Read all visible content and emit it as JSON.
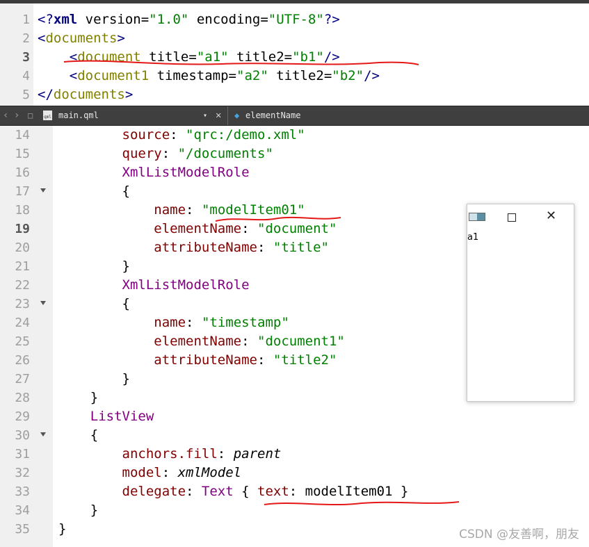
{
  "xml_editor": {
    "lines": [
      {
        "num": "1",
        "parts": [
          [
            "t-punc",
            "<?"
          ],
          [
            "t-kw",
            "xml"
          ],
          [
            "",
            " version="
          ],
          [
            "t-str",
            "\"1.0\""
          ],
          [
            "",
            " encoding="
          ],
          [
            "t-str",
            "\"UTF-8\""
          ],
          [
            "t-punc",
            "?>"
          ]
        ]
      },
      {
        "num": "2",
        "parts": [
          [
            "t-punc",
            "<"
          ],
          [
            "t-tag",
            "documents"
          ],
          [
            "t-punc",
            ">"
          ]
        ]
      },
      {
        "num": "3",
        "active": true,
        "parts": [
          [
            "",
            "    "
          ],
          [
            "t-punc",
            "<"
          ],
          [
            "t-tag",
            "document"
          ],
          [
            "",
            " title="
          ],
          [
            "t-str",
            "\"a1\""
          ],
          [
            "",
            " title2="
          ],
          [
            "t-str",
            "\"b1\""
          ],
          [
            "t-punc",
            "/>"
          ]
        ]
      },
      {
        "num": "4",
        "parts": [
          [
            "",
            "    "
          ],
          [
            "t-punc",
            "<"
          ],
          [
            "t-tag",
            "document1"
          ],
          [
            "",
            " timestamp="
          ],
          [
            "t-str",
            "\"a2\""
          ],
          [
            "",
            " title2="
          ],
          [
            "t-str",
            "\"b2\""
          ],
          [
            "t-punc",
            "/>"
          ]
        ]
      },
      {
        "num": "5",
        "parts": [
          [
            "t-punc",
            "</"
          ],
          [
            "t-tag",
            "documents"
          ],
          [
            "t-punc",
            ">"
          ]
        ]
      }
    ]
  },
  "toolbar": {
    "file_name": "main.qml",
    "symbol_name": "elementName",
    "file_icon_label": "qml"
  },
  "qml_editor": {
    "lines": [
      {
        "num": "14",
        "parts": [
          [
            "",
            "        "
          ],
          [
            "t-prop",
            "source"
          ],
          [
            "",
            ": "
          ],
          [
            "t-str",
            "\"qrc:/demo.xml\""
          ]
        ]
      },
      {
        "num": "15",
        "parts": [
          [
            "",
            "        "
          ],
          [
            "t-prop",
            "query"
          ],
          [
            "",
            ": "
          ],
          [
            "t-str",
            "\"/documents\""
          ]
        ]
      },
      {
        "num": "16",
        "parts": [
          [
            "",
            "        "
          ],
          [
            "t-type",
            "XmlListModelRole"
          ]
        ]
      },
      {
        "num": "17",
        "fold": true,
        "parts": [
          [
            "",
            "        {"
          ]
        ]
      },
      {
        "num": "18",
        "parts": [
          [
            "",
            "            "
          ],
          [
            "t-prop",
            "name"
          ],
          [
            "",
            ": "
          ],
          [
            "t-str",
            "\"modelItem01\""
          ]
        ]
      },
      {
        "num": "19",
        "active": true,
        "parts": [
          [
            "",
            "            "
          ],
          [
            "t-prop",
            "elementName"
          ],
          [
            "",
            ": "
          ],
          [
            "t-str",
            "\"document\""
          ]
        ]
      },
      {
        "num": "20",
        "parts": [
          [
            "",
            "            "
          ],
          [
            "t-prop",
            "attributeName"
          ],
          [
            "",
            ": "
          ],
          [
            "t-str",
            "\"title\""
          ]
        ]
      },
      {
        "num": "21",
        "parts": [
          [
            "",
            "        }"
          ]
        ]
      },
      {
        "num": "22",
        "parts": [
          [
            "",
            "        "
          ],
          [
            "t-type",
            "XmlListModelRole"
          ]
        ]
      },
      {
        "num": "23",
        "fold": true,
        "parts": [
          [
            "",
            "        {"
          ]
        ]
      },
      {
        "num": "24",
        "parts": [
          [
            "",
            "            "
          ],
          [
            "t-prop",
            "name"
          ],
          [
            "",
            ": "
          ],
          [
            "t-str",
            "\"timestamp\""
          ]
        ]
      },
      {
        "num": "25",
        "parts": [
          [
            "",
            "            "
          ],
          [
            "t-prop",
            "elementName"
          ],
          [
            "",
            ": "
          ],
          [
            "t-str",
            "\"document1\""
          ]
        ]
      },
      {
        "num": "26",
        "parts": [
          [
            "",
            "            "
          ],
          [
            "t-prop",
            "attributeName"
          ],
          [
            "",
            ": "
          ],
          [
            "t-str",
            "\"title2\""
          ]
        ]
      },
      {
        "num": "27",
        "parts": [
          [
            "",
            "        }"
          ]
        ]
      },
      {
        "num": "28",
        "parts": [
          [
            "",
            "    }"
          ]
        ]
      },
      {
        "num": "29",
        "parts": [
          [
            "",
            "    "
          ],
          [
            "t-type",
            "ListView"
          ]
        ]
      },
      {
        "num": "30",
        "fold": true,
        "parts": [
          [
            "",
            "    {"
          ]
        ]
      },
      {
        "num": "31",
        "parts": [
          [
            "",
            "        "
          ],
          [
            "t-prop",
            "anchors.fill"
          ],
          [
            "",
            ": "
          ],
          [
            "t-it",
            "parent"
          ]
        ]
      },
      {
        "num": "32",
        "parts": [
          [
            "",
            "        "
          ],
          [
            "t-prop",
            "model"
          ],
          [
            "",
            ": "
          ],
          [
            "t-it",
            "xmlModel"
          ]
        ]
      },
      {
        "num": "33",
        "parts": [
          [
            "",
            "        "
          ],
          [
            "t-prop",
            "delegate"
          ],
          [
            "",
            ": "
          ],
          [
            "t-type",
            "Text"
          ],
          [
            "",
            " { "
          ],
          [
            "t-prop",
            "text"
          ],
          [
            "",
            ": modelItem01 }"
          ]
        ]
      },
      {
        "num": "34",
        "parts": [
          [
            "",
            "    }"
          ]
        ]
      },
      {
        "num": "35",
        "parts": [
          [
            "",
            "}"
          ]
        ]
      }
    ]
  },
  "app_window": {
    "label": "a1"
  },
  "watermark": "CSDN @友善啊，朋友"
}
